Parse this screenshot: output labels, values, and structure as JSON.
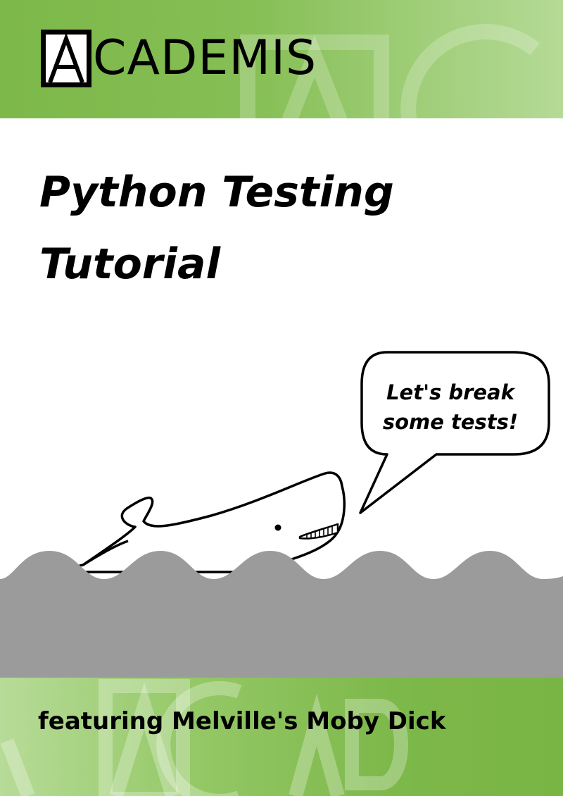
{
  "brand": {
    "logo_letter": "A",
    "logo_text": "CADEMIS",
    "watermark_text": "ACADEMIS"
  },
  "title": {
    "line1": "Python Testing",
    "line2": "Tutorial"
  },
  "speech_bubble": {
    "line1": "Let's break",
    "line2": "some tests!"
  },
  "subtitle": "featuring Melville's Moby Dick",
  "colors": {
    "band_green": "#7db84a",
    "band_light_green": "#b5da96",
    "sea_gray": "#9b9b9b",
    "ink": "#000000"
  },
  "illustration": {
    "subject": "whale-icon",
    "element": "sea-waves"
  }
}
